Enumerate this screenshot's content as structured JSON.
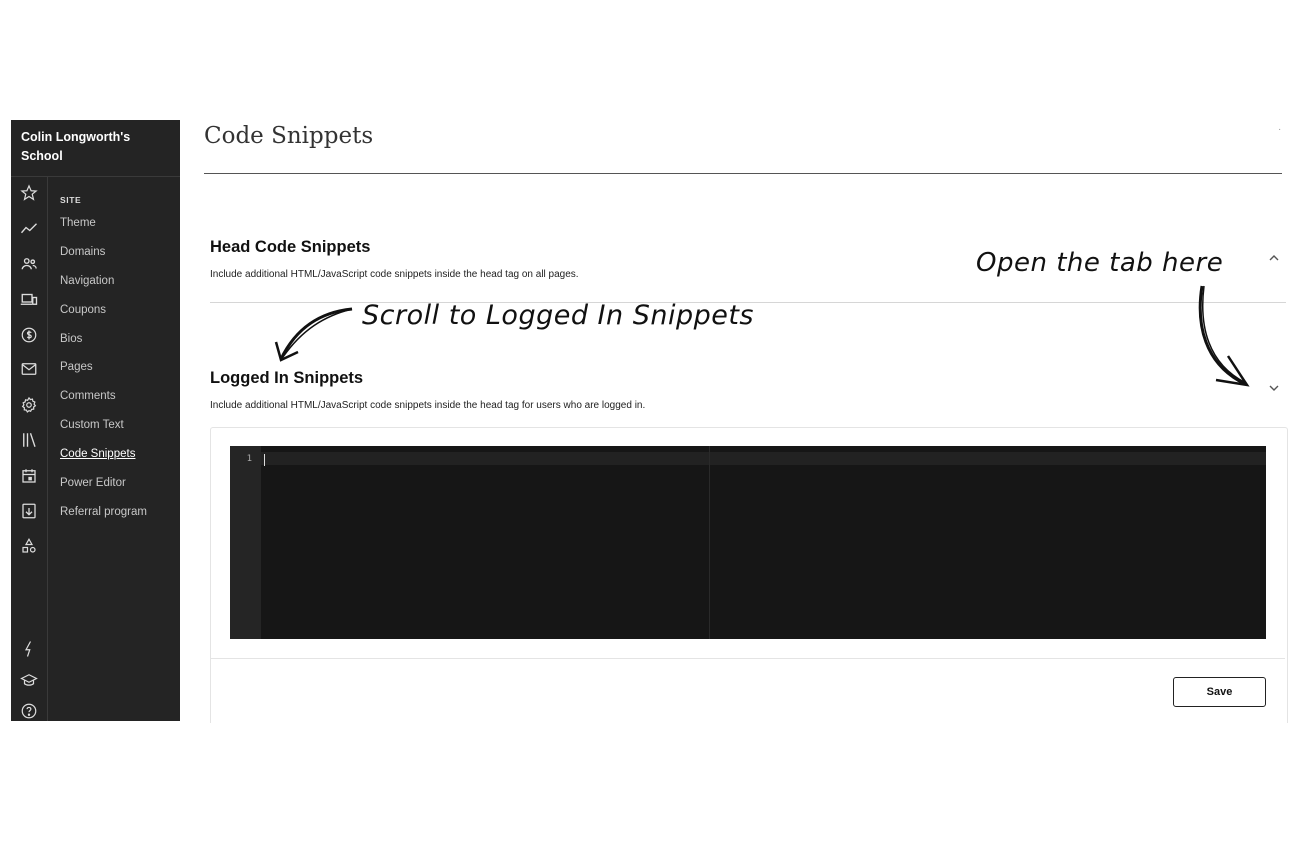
{
  "sidebar": {
    "school_name": "Colin Longworth's School",
    "section_heading": "SITE",
    "items": [
      {
        "label": "Theme",
        "active": false
      },
      {
        "label": "Domains",
        "active": false
      },
      {
        "label": "Navigation",
        "active": false
      },
      {
        "label": "Coupons",
        "active": false
      },
      {
        "label": "Bios",
        "active": false
      },
      {
        "label": "Pages",
        "active": false
      },
      {
        "label": "Comments",
        "active": false
      },
      {
        "label": "Custom Text",
        "active": false
      },
      {
        "label": "Code Snippets",
        "active": true
      },
      {
        "label": "Power Editor",
        "active": false
      },
      {
        "label": "Referral program",
        "active": false
      }
    ],
    "rail_icons": [
      "star-icon",
      "analytics-icon",
      "users-icon",
      "devices-icon",
      "dollar-icon",
      "mail-icon",
      "gear-icon",
      "library-icon",
      "calendar-icon",
      "download-icon",
      "shapes-icon",
      "bolt-icon",
      "graduation-cap-icon",
      "help-icon"
    ]
  },
  "page": {
    "title": "Code Snippets"
  },
  "head_section": {
    "title": "Head Code Snippets",
    "description": "Include additional HTML/JavaScript code snippets inside the head tag on all pages.",
    "toggle_icon": "chevron-up-icon"
  },
  "logged_in_section": {
    "title": "Logged In Snippets",
    "description": "Include additional HTML/JavaScript code snippets inside the head tag for users who are logged in.",
    "toggle_icon": "chevron-down-icon"
  },
  "editor": {
    "line_number": "1"
  },
  "save_label": "Save",
  "annotations": {
    "scroll_note": "Scroll to Logged In Snippets",
    "open_note": "Open the tab here"
  }
}
